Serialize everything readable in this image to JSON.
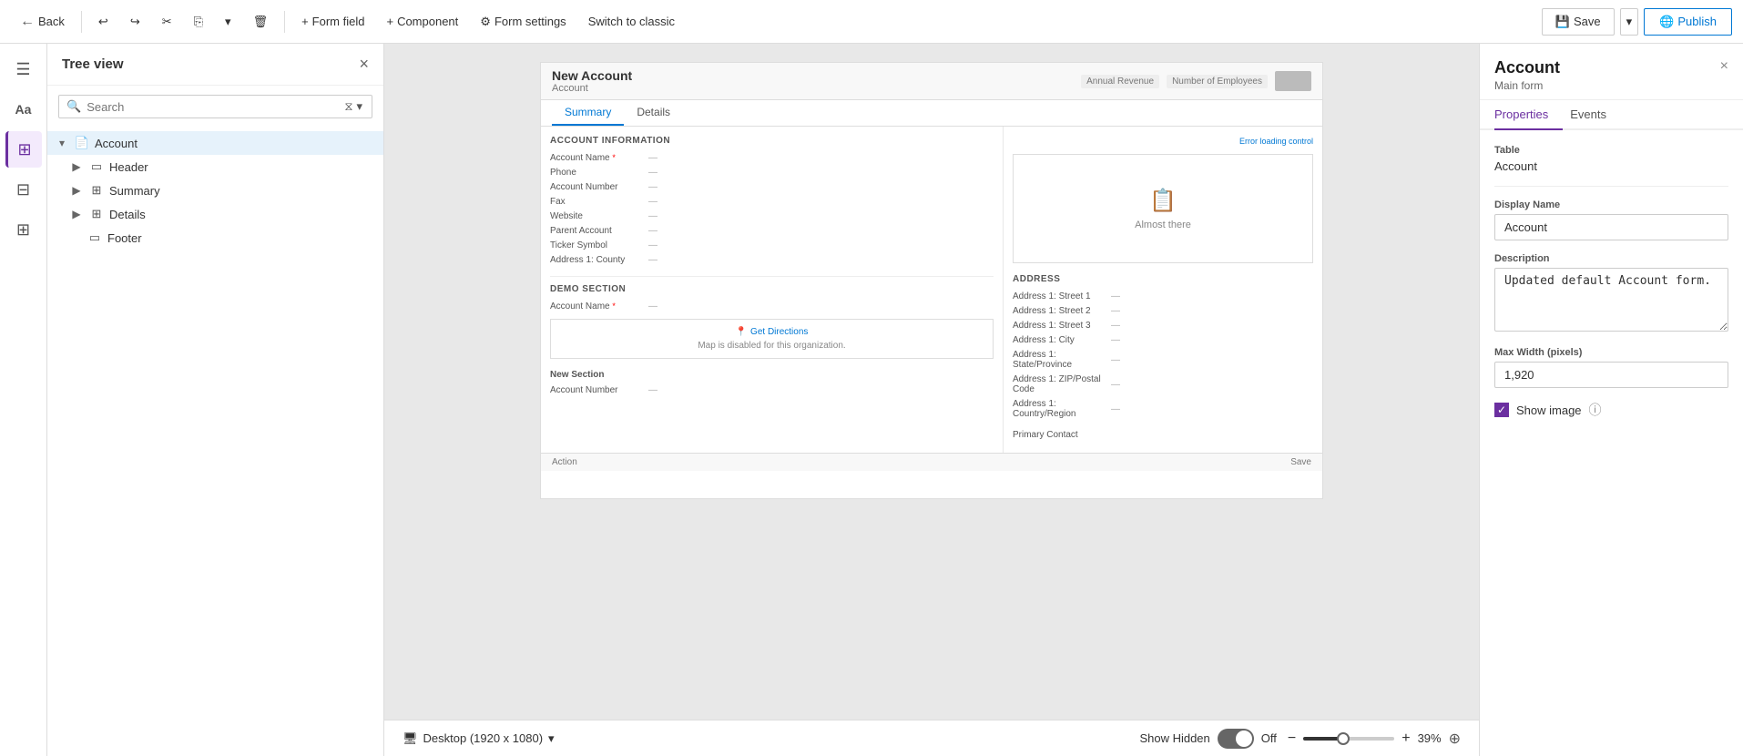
{
  "toolbar": {
    "back_label": "Back",
    "undo_icon": "↩",
    "redo_icon": "↪",
    "cut_icon": "✂",
    "copy_icon": "⎘",
    "dropdown_icon": "▾",
    "delete_icon": "🗑",
    "form_field_label": "Form field",
    "component_label": "Component",
    "form_settings_label": "Form settings",
    "switch_classic_label": "Switch to classic",
    "save_label": "Save",
    "publish_label": "Publish"
  },
  "sidebar": {
    "title": "Tree view",
    "search_placeholder": "Search",
    "items": [
      {
        "label": "Account",
        "level": 0,
        "type": "form",
        "expandable": true,
        "selected": true
      },
      {
        "label": "Header",
        "level": 1,
        "type": "section",
        "expandable": true
      },
      {
        "label": "Summary",
        "level": 1,
        "type": "table",
        "expandable": true
      },
      {
        "label": "Details",
        "level": 1,
        "type": "table",
        "expandable": true
      },
      {
        "label": "Footer",
        "level": 2,
        "type": "section",
        "expandable": false
      }
    ]
  },
  "canvas": {
    "form": {
      "title": "New Account",
      "subtitle": "Account",
      "header_controls": [
        "Annual Revenue",
        "Number of Employees"
      ],
      "tabs": [
        "Summary",
        "Details"
      ],
      "active_tab": "Summary",
      "sections": {
        "account_information": {
          "title": "ACCOUNT INFORMATION",
          "fields": [
            {
              "label": "Account Name",
              "required": true,
              "value": "—"
            },
            {
              "label": "Phone",
              "value": "—"
            },
            {
              "label": "Account Number",
              "value": "—"
            },
            {
              "label": "Fax",
              "value": "—"
            },
            {
              "label": "Website",
              "value": "—"
            },
            {
              "label": "Parent Account",
              "value": "—"
            },
            {
              "label": "Ticker Symbol",
              "value": "—"
            },
            {
              "label": "Address 1: County",
              "value": "—"
            }
          ]
        },
        "demo_section": {
          "title": "Demo Section",
          "fields": [
            {
              "label": "Account Name",
              "required": true,
              "value": "—"
            }
          ]
        },
        "new_section": {
          "title": "New Section",
          "fields": [
            {
              "label": "Account Number",
              "value": "—"
            }
          ]
        },
        "address": {
          "title": "ADDRESS",
          "fields": [
            {
              "label": "Address 1: Street 1",
              "value": "—"
            },
            {
              "label": "Address 1: Street 2",
              "value": "—"
            },
            {
              "label": "Address 1: Street 3",
              "value": "—"
            },
            {
              "label": "Address 1: City",
              "value": "—"
            },
            {
              "label": "Address 1: State/Province",
              "value": "—"
            },
            {
              "label": "Address 1: ZIP/Postal Code",
              "value": "—"
            },
            {
              "label": "Address 1: Country/Region",
              "value": "—"
            }
          ]
        }
      },
      "timeline": {
        "icon": "📋",
        "text": "Almost there"
      },
      "primary_contact_label": "Primary Contact",
      "error_link": "Error loading control",
      "map_get_directions": "Get Directions",
      "map_disabled_text": "Map is disabled for this organization.",
      "footer_action": "Action",
      "footer_save": "Save"
    }
  },
  "bottom_bar": {
    "desktop_label": "Desktop (1920 x 1080)",
    "show_hidden_label": "Show Hidden",
    "toggle_state": "Off",
    "zoom_label": "39%"
  },
  "right_panel": {
    "title": "Account",
    "subtitle": "Main form",
    "tabs": [
      "Properties",
      "Events"
    ],
    "active_tab": "Properties",
    "table_label": "Table",
    "table_value": "Account",
    "display_name_label": "Display Name",
    "display_name_value": "Account",
    "description_label": "Description",
    "description_value": "Updated default Account form.",
    "max_width_label": "Max Width (pixels)",
    "max_width_value": "1,920",
    "show_image_label": "Show image",
    "show_image_checked": true
  }
}
